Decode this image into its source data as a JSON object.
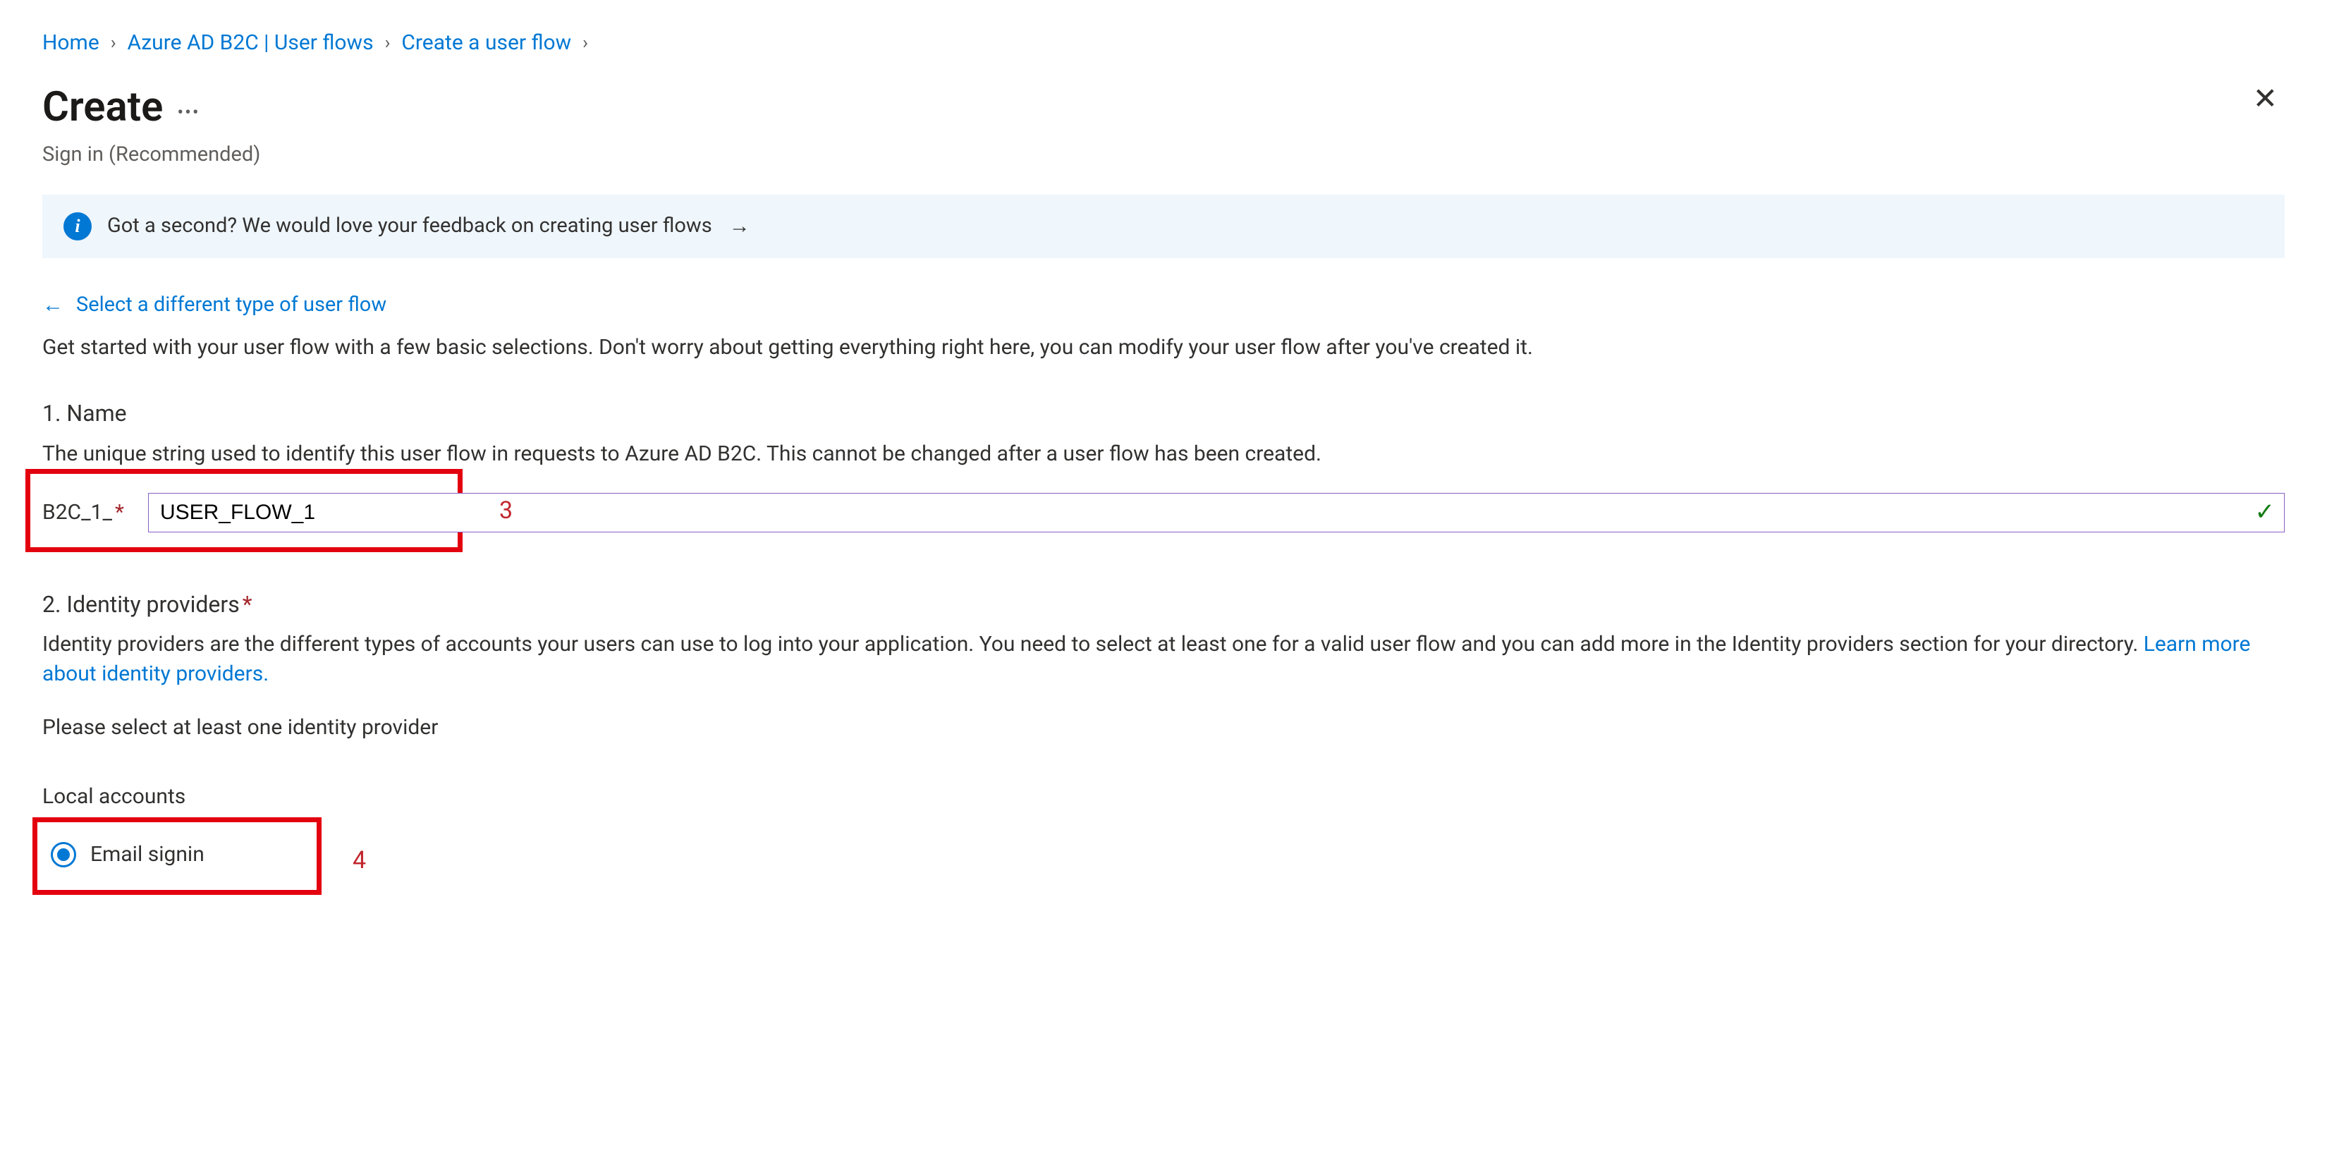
{
  "breadcrumb": {
    "home": "Home",
    "flows": "Azure AD B2C | User flows",
    "create": "Create a user flow"
  },
  "header": {
    "title": "Create",
    "subtitle": "Sign in (Recommended)"
  },
  "feedback": {
    "text": "Got a second? We would love your feedback on creating user flows"
  },
  "back_link": "Select a different type of user flow",
  "intro": "Get started with your user flow with a few basic selections. Don't worry about getting everything right here, you can modify your user flow after you've created it.",
  "section_name": {
    "heading": "1. Name",
    "desc": "The unique string used to identify this user flow in requests to Azure AD B2C. This cannot be changed after a user flow has been created.",
    "prefix": "B2C_1_",
    "value": "USER_FLOW_1"
  },
  "section_idp": {
    "heading": "2. Identity providers",
    "desc_pre": "Identity providers are the different types of accounts your users can use to log into your application. You need to select at least one for a valid user flow and you can add more in the Identity providers section for your directory. ",
    "learn_more": "Learn more about identity providers.",
    "select_msg": "Please select at least one identity provider",
    "local_label": "Local accounts",
    "radio_email": "Email signin"
  },
  "annotations": {
    "step3": "3",
    "step4": "4"
  }
}
